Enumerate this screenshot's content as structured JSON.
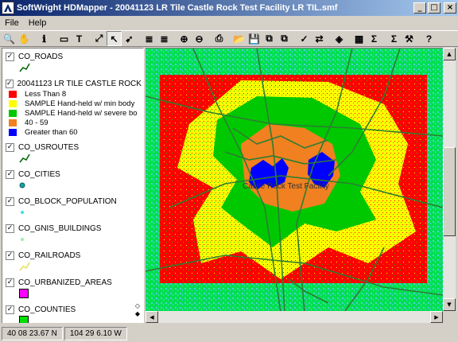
{
  "window": {
    "title": "SoftWright HDMapper - 20041123 LR Tile Castle Rock Test Facility LR TIL.smf",
    "minimize": "_",
    "maximize": "□",
    "close": "×"
  },
  "menu": [
    "File",
    "Help"
  ],
  "toolbar": [
    {
      "name": "zoom-tool-icon",
      "glyph": "🔍"
    },
    {
      "name": "pan-hand-icon",
      "glyph": "✋"
    },
    {
      "name": "info-icon",
      "glyph": "ℹ"
    },
    {
      "name": "select-box-icon",
      "glyph": "▭"
    },
    {
      "name": "text-tool-icon",
      "glyph": "T"
    },
    {
      "name": "measure-line-icon",
      "glyph": "⤢"
    },
    {
      "name": "pointer-arrow-icon",
      "glyph": "↖"
    },
    {
      "name": "edit-pointer-icon",
      "glyph": "➹"
    },
    {
      "name": "layers-icon",
      "glyph": "≣"
    },
    {
      "name": "layers-edit-icon",
      "glyph": "≣"
    },
    {
      "name": "zoom-in-icon",
      "glyph": "⊕"
    },
    {
      "name": "zoom-out-icon",
      "glyph": "⊖"
    },
    {
      "name": "print-icon",
      "glyph": "⎙"
    },
    {
      "name": "open-folder-icon",
      "glyph": "📂"
    },
    {
      "name": "save-icon",
      "glyph": "💾"
    },
    {
      "name": "export-icon",
      "glyph": "⧉"
    },
    {
      "name": "import-icon",
      "glyph": "⧉"
    },
    {
      "name": "check-edit-icon",
      "glyph": "✓"
    },
    {
      "name": "transfer-icon",
      "glyph": "⇄"
    },
    {
      "name": "stack-icon",
      "glyph": "◈"
    },
    {
      "name": "table-icon",
      "glyph": "▦"
    },
    {
      "name": "sum-icon",
      "glyph": "Σ"
    },
    {
      "name": "sum-plus-icon",
      "glyph": "Σ"
    },
    {
      "name": "tools-icon",
      "glyph": "⚒"
    },
    {
      "name": "help-icon",
      "glyph": "?"
    }
  ],
  "legend": {
    "layers": [
      {
        "name": "CO_ROADS",
        "checked": true,
        "symbol": "line",
        "color": "#006400"
      },
      {
        "name": "20041123 LR TILE CASTLE ROCK TE",
        "checked": true,
        "symbol": "classes"
      },
      {
        "name": "CO_USROUTES",
        "checked": true,
        "symbol": "line",
        "color": "#006400"
      },
      {
        "name": "CO_CITIES",
        "checked": true,
        "symbol": "dot",
        "color": "#1fa0a0"
      },
      {
        "name": "CO_BLOCK_POPULATION",
        "checked": true,
        "symbol": "smalldot",
        "color": "#40e0e0"
      },
      {
        "name": "CO_GNIS_BUILDINGS",
        "checked": true,
        "symbol": "smalldot",
        "color": "#a0f0a0"
      },
      {
        "name": "CO_RAILROADS",
        "checked": true,
        "symbol": "line",
        "color": "#e0e060"
      },
      {
        "name": "CO_URBANIZED_AREAS",
        "checked": true,
        "symbol": "square",
        "color": "#ff00ff"
      },
      {
        "name": "CO_COUNTIES",
        "checked": true,
        "symbol": "square",
        "color": "#00e000"
      }
    ],
    "classes": [
      {
        "label": "Less Than 8",
        "color": "#ff0000"
      },
      {
        "label": "SAMPLE Hand-held w/ min body",
        "color": "#ffff00"
      },
      {
        "label": "SAMPLE Hand-held w/ severe bo",
        "color": "#00c800"
      },
      {
        "label": "40 - 59",
        "color": "#f08020"
      },
      {
        "label": "Greater than 60",
        "color": "#0000ff"
      }
    ]
  },
  "map": {
    "site_label": "Castle Rock Test Facility",
    "colors": {
      "background": "#4cd0d8",
      "outer_green": "#00e050",
      "red": "#ff0000",
      "yellow": "#ffff00",
      "green": "#00c800",
      "orange": "#f08020",
      "blue": "#0000ff",
      "roads": "#2e7d32"
    }
  },
  "status": {
    "latitude": "40 08 23.67 N",
    "longitude": "104 29 6.10 W"
  }
}
